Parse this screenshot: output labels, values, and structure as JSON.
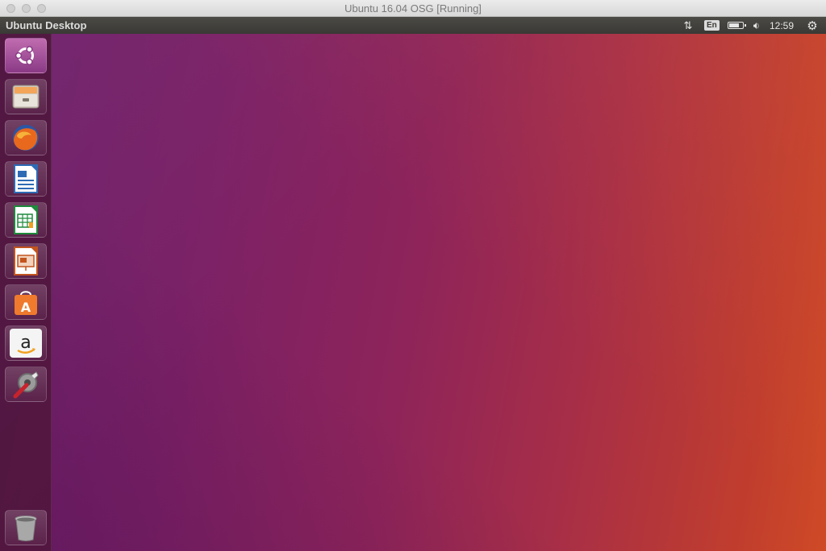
{
  "window": {
    "title": "Ubuntu 16.04 OSG [Running]"
  },
  "panel": {
    "title": "Ubuntu Desktop",
    "indicators": {
      "network_icon": "network-transfer-icon",
      "keyboard_layout": "En",
      "battery_icon": "battery-icon",
      "battery_level_percent": 80,
      "volume_icon": "volume-icon",
      "clock": "12:59",
      "session_icon": "gear-icon"
    }
  },
  "launcher": {
    "items": [
      {
        "name": "dash-home",
        "icon": "ubuntu-logo-icon"
      },
      {
        "name": "files",
        "icon": "file-cabinet-icon"
      },
      {
        "name": "firefox",
        "icon": "firefox-icon"
      },
      {
        "name": "libreoffice-writer",
        "icon": "writer-document-icon"
      },
      {
        "name": "libreoffice-calc",
        "icon": "calc-spreadsheet-icon"
      },
      {
        "name": "libreoffice-impress",
        "icon": "impress-presentation-icon"
      },
      {
        "name": "ubuntu-software",
        "icon": "shopping-bag-icon"
      },
      {
        "name": "amazon",
        "icon": "amazon-icon"
      },
      {
        "name": "system-settings",
        "icon": "settings-wrench-icon"
      }
    ],
    "trash": {
      "name": "trash",
      "icon": "trash-icon"
    }
  },
  "colors": {
    "launcher_active": "#9b4a94",
    "panel": "#3c3b37",
    "desktop_left": "#6b1f6a",
    "desktop_right": "#cf4a26"
  }
}
